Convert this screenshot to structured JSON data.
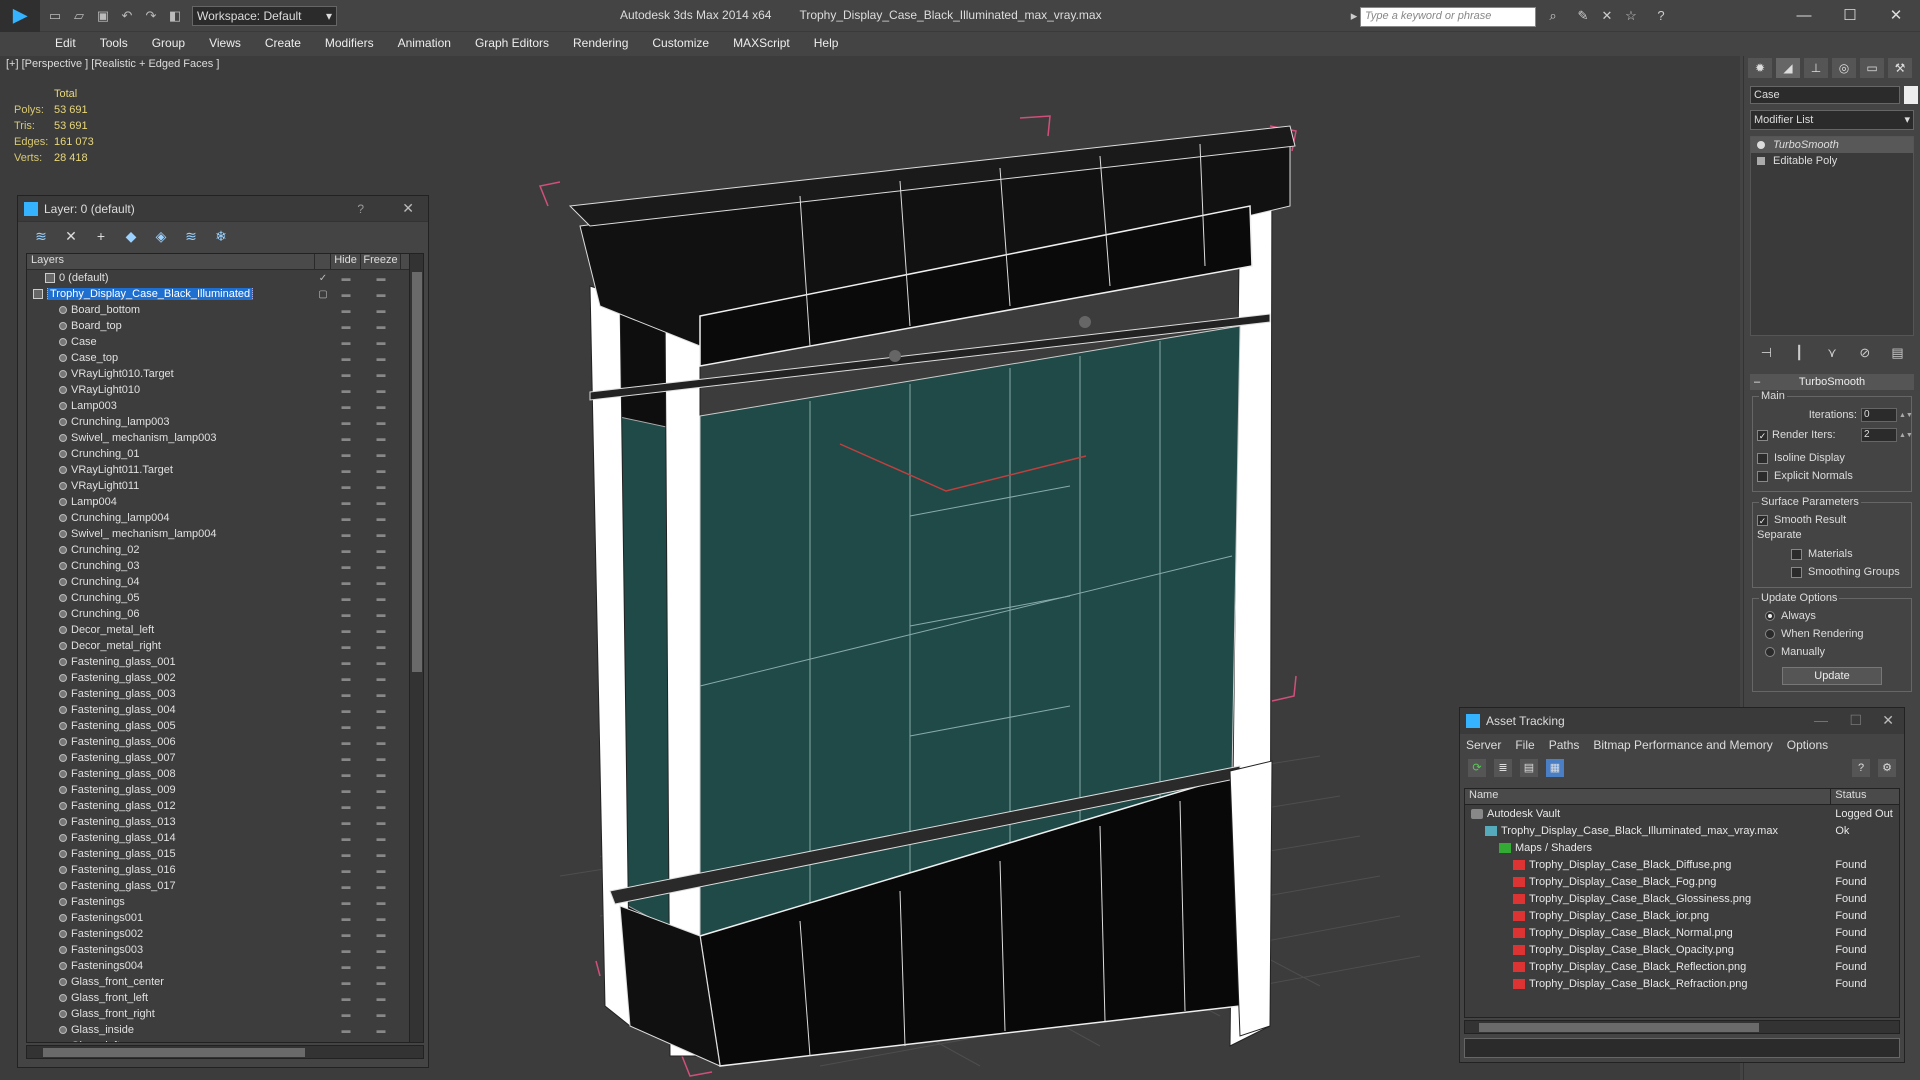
{
  "titlebar": {
    "workspace": "Workspace: Default",
    "app_name": "Autodesk 3ds Max  2014 x64",
    "file_name": "Trophy_Display_Case_Black_Illuminated_max_vray.max",
    "search_placeholder": "Type a keyword or phrase"
  },
  "menu": [
    "Edit",
    "Tools",
    "Group",
    "Views",
    "Create",
    "Modifiers",
    "Animation",
    "Graph Editors",
    "Rendering",
    "Customize",
    "MAXScript",
    "Help"
  ],
  "viewport": {
    "label": "[+] [Perspective ] [Realistic + Edged Faces ]",
    "stats": {
      "header": "Total",
      "rows": [
        {
          "label": "Polys:",
          "value": "53 691"
        },
        {
          "label": "Tris:",
          "value": "53 691"
        },
        {
          "label": "Edges:",
          "value": "161 073"
        },
        {
          "label": "Verts:",
          "value": "28 418"
        }
      ]
    }
  },
  "layer_panel": {
    "title": "Layer: 0 (default)",
    "help": "?",
    "col_layers": "Layers",
    "col_hide": "Hide",
    "col_freeze": "Freeze",
    "layers": [
      {
        "name": "0 (default)",
        "type": "layer",
        "indent": 1,
        "checked": true
      },
      {
        "name": "Trophy_Display_Case_Black_Illuminated",
        "type": "layer",
        "indent": 0,
        "selected": true
      },
      {
        "name": "Board_bottom",
        "type": "obj",
        "indent": 2
      },
      {
        "name": "Board_top",
        "type": "obj",
        "indent": 2
      },
      {
        "name": "Case",
        "type": "obj",
        "indent": 2
      },
      {
        "name": "Case_top",
        "type": "obj",
        "indent": 2
      },
      {
        "name": "VRayLight010.Target",
        "type": "obj",
        "indent": 2
      },
      {
        "name": "VRayLight010",
        "type": "obj",
        "indent": 2
      },
      {
        "name": "Lamp003",
        "type": "obj",
        "indent": 2
      },
      {
        "name": "Crunching_lamp003",
        "type": "obj",
        "indent": 2
      },
      {
        "name": "Swivel_ mechanism_lamp003",
        "type": "obj",
        "indent": 2
      },
      {
        "name": "Crunching_01",
        "type": "obj",
        "indent": 2
      },
      {
        "name": "VRayLight011.Target",
        "type": "obj",
        "indent": 2
      },
      {
        "name": "VRayLight011",
        "type": "obj",
        "indent": 2
      },
      {
        "name": "Lamp004",
        "type": "obj",
        "indent": 2
      },
      {
        "name": "Crunching_lamp004",
        "type": "obj",
        "indent": 2
      },
      {
        "name": "Swivel_ mechanism_lamp004",
        "type": "obj",
        "indent": 2
      },
      {
        "name": "Crunching_02",
        "type": "obj",
        "indent": 2
      },
      {
        "name": "Crunching_03",
        "type": "obj",
        "indent": 2
      },
      {
        "name": "Crunching_04",
        "type": "obj",
        "indent": 2
      },
      {
        "name": "Crunching_05",
        "type": "obj",
        "indent": 2
      },
      {
        "name": "Crunching_06",
        "type": "obj",
        "indent": 2
      },
      {
        "name": "Decor_metal_left",
        "type": "obj",
        "indent": 2
      },
      {
        "name": "Decor_metal_right",
        "type": "obj",
        "indent": 2
      },
      {
        "name": "Fastening_glass_001",
        "type": "obj",
        "indent": 2
      },
      {
        "name": "Fastening_glass_002",
        "type": "obj",
        "indent": 2
      },
      {
        "name": "Fastening_glass_003",
        "type": "obj",
        "indent": 2
      },
      {
        "name": "Fastening_glass_004",
        "type": "obj",
        "indent": 2
      },
      {
        "name": "Fastening_glass_005",
        "type": "obj",
        "indent": 2
      },
      {
        "name": "Fastening_glass_006",
        "type": "obj",
        "indent": 2
      },
      {
        "name": "Fastening_glass_007",
        "type": "obj",
        "indent": 2
      },
      {
        "name": "Fastening_glass_008",
        "type": "obj",
        "indent": 2
      },
      {
        "name": "Fastening_glass_009",
        "type": "obj",
        "indent": 2
      },
      {
        "name": "Fastening_glass_012",
        "type": "obj",
        "indent": 2
      },
      {
        "name": "Fastening_glass_013",
        "type": "obj",
        "indent": 2
      },
      {
        "name": "Fastening_glass_014",
        "type": "obj",
        "indent": 2
      },
      {
        "name": "Fastening_glass_015",
        "type": "obj",
        "indent": 2
      },
      {
        "name": "Fastening_glass_016",
        "type": "obj",
        "indent": 2
      },
      {
        "name": "Fastening_glass_017",
        "type": "obj",
        "indent": 2
      },
      {
        "name": "Fastenings",
        "type": "obj",
        "indent": 2
      },
      {
        "name": "Fastenings001",
        "type": "obj",
        "indent": 2
      },
      {
        "name": "Fastenings002",
        "type": "obj",
        "indent": 2
      },
      {
        "name": "Fastenings003",
        "type": "obj",
        "indent": 2
      },
      {
        "name": "Fastenings004",
        "type": "obj",
        "indent": 2
      },
      {
        "name": "Glass_front_center",
        "type": "obj",
        "indent": 2
      },
      {
        "name": "Glass_front_left",
        "type": "obj",
        "indent": 2
      },
      {
        "name": "Glass_front_right",
        "type": "obj",
        "indent": 2
      },
      {
        "name": "Glass_inside",
        "type": "obj",
        "indent": 2
      },
      {
        "name": "Glass_left",
        "type": "obj",
        "indent": 2
      }
    ]
  },
  "command_panel": {
    "object_name": "Case",
    "modifier_list": "Modifier List",
    "stack": [
      {
        "name": "TurboSmooth",
        "active": true
      },
      {
        "name": "Editable Poly",
        "active": false
      }
    ],
    "rollout_title": "TurboSmooth",
    "main_group": "Main",
    "iterations_label": "Iterations:",
    "iterations_value": "0",
    "render_iters_label": "Render Iters:",
    "render_iters_value": "2",
    "isoline_label": "Isoline Display",
    "explicit_normals_label": "Explicit Normals",
    "surface_group": "Surface Parameters",
    "smooth_result_label": "Smooth Result",
    "separate_label": "Separate",
    "materials_label": "Materials",
    "smoothing_groups_label": "Smoothing Groups",
    "update_group": "Update Options",
    "always_label": "Always",
    "when_rendering_label": "When Rendering",
    "manually_label": "Manually",
    "update_button": "Update"
  },
  "asset_tracking": {
    "title": "Asset Tracking",
    "menu": [
      "Server",
      "File",
      "Paths",
      "Bitmap Performance and Memory",
      "Options"
    ],
    "col_name": "Name",
    "col_status": "Status",
    "rows": [
      {
        "name": "Autodesk Vault",
        "status": "Logged Out",
        "icon": "vault",
        "indent": 0
      },
      {
        "name": "Trophy_Display_Case_Black_Illuminated_max_vray.max",
        "status": "Ok",
        "icon": "max",
        "indent": 1
      },
      {
        "name": "Maps / Shaders",
        "status": "",
        "icon": "folder",
        "indent": 2
      },
      {
        "name": "Trophy_Display_Case_Black_Diffuse.png",
        "status": "Found",
        "icon": "png",
        "indent": 3
      },
      {
        "name": "Trophy_Display_Case_Black_Fog.png",
        "status": "Found",
        "icon": "png",
        "indent": 3
      },
      {
        "name": "Trophy_Display_Case_Black_Glossiness.png",
        "status": "Found",
        "icon": "png",
        "indent": 3
      },
      {
        "name": "Trophy_Display_Case_Black_ior.png",
        "status": "Found",
        "icon": "png",
        "indent": 3
      },
      {
        "name": "Trophy_Display_Case_Black_Normal.png",
        "status": "Found",
        "icon": "png",
        "indent": 3
      },
      {
        "name": "Trophy_Display_Case_Black_Opacity.png",
        "status": "Found",
        "icon": "png",
        "indent": 3
      },
      {
        "name": "Trophy_Display_Case_Black_Reflection.png",
        "status": "Found",
        "icon": "png",
        "indent": 3
      },
      {
        "name": "Trophy_Display_Case_Black_Refraction.png",
        "status": "Found",
        "icon": "png",
        "indent": 3
      }
    ]
  },
  "colors": {
    "accent": "#35b3ff",
    "selection": "#1f6fd1",
    "stats_text": "#e8d77b",
    "glass": "#1f4a47",
    "bbox": "#d0507a"
  }
}
